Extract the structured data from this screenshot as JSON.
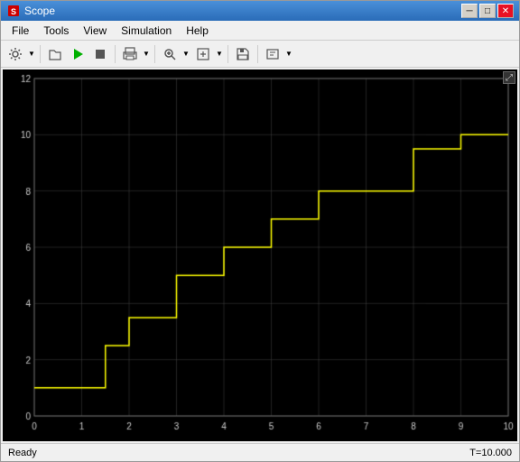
{
  "window": {
    "title": "Scope"
  },
  "title_buttons": {
    "minimize": "─",
    "maximize": "□",
    "close": "✕"
  },
  "menu": {
    "items": [
      "File",
      "Tools",
      "View",
      "Simulation",
      "Help"
    ]
  },
  "toolbar": {
    "buttons": [
      {
        "name": "settings",
        "icon": "⚙"
      },
      {
        "name": "run",
        "icon": "▶"
      },
      {
        "name": "stop",
        "icon": "■"
      },
      {
        "name": "print",
        "icon": "🖨"
      },
      {
        "name": "zoom-in",
        "icon": "🔍"
      },
      {
        "name": "zoom-out",
        "icon": "🔎"
      },
      {
        "name": "save",
        "icon": "💾"
      },
      {
        "name": "config",
        "icon": "⚙"
      }
    ]
  },
  "plot": {
    "background": "#000000",
    "line_color": "#ffff00",
    "x_axis": {
      "min": 0,
      "max": 10,
      "ticks": [
        0,
        1,
        2,
        3,
        4,
        5,
        6,
        7,
        8,
        9,
        10
      ]
    },
    "y_axis": {
      "min": 0,
      "max": 12,
      "ticks": [
        0,
        2,
        4,
        6,
        8,
        10,
        12
      ]
    },
    "data": [
      [
        0,
        1
      ],
      [
        1,
        1
      ],
      [
        1,
        1
      ],
      [
        1.5,
        1
      ],
      [
        1.5,
        2.5
      ],
      [
        2,
        2.5
      ],
      [
        2,
        3.5
      ],
      [
        3,
        3.5
      ],
      [
        3,
        5
      ],
      [
        4,
        5
      ],
      [
        4,
        6
      ],
      [
        5,
        6
      ],
      [
        5,
        7
      ],
      [
        6,
        7
      ],
      [
        6,
        8
      ],
      [
        7,
        8
      ],
      [
        7,
        8
      ],
      [
        8,
        8
      ],
      [
        8,
        9.5
      ],
      [
        9,
        9.5
      ],
      [
        9,
        10
      ],
      [
        10,
        10
      ]
    ]
  },
  "status": {
    "left": "Ready",
    "right": "T=10.000"
  }
}
